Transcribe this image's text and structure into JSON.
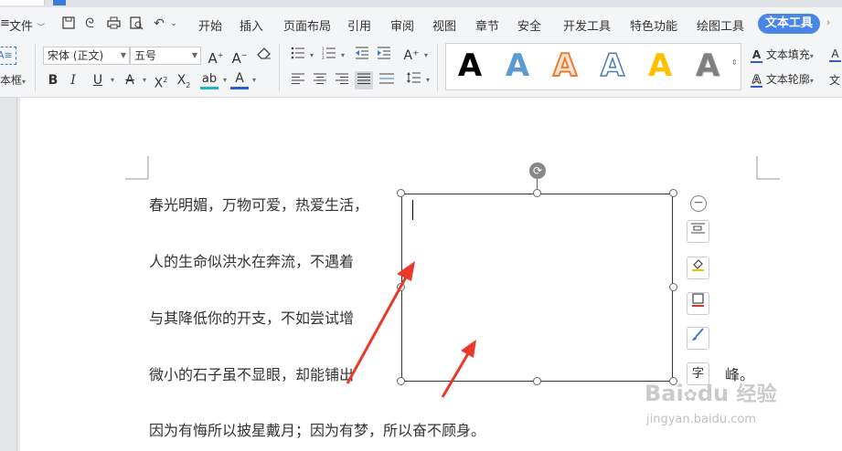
{
  "menubar": {
    "file_label": "文件",
    "tabs": [
      "开始",
      "插入",
      "页面布局",
      "引用",
      "审阅",
      "视图",
      "章节",
      "安全",
      "开发工具",
      "特色功能",
      "绘图工具",
      "文本工具"
    ],
    "active_tab": "文本工具"
  },
  "ribbon": {
    "textbox_label": "本框",
    "font_name": "宋体 (正文)",
    "font_size": "五号",
    "text_fill_label": "文本填充",
    "text_outline_label": "文本轮廓",
    "cut_label": "文"
  },
  "document": {
    "paragraphs": [
      "春光明媚，万物可爱，热爱生活，",
      "人的生命似洪水在奔流，不遇着",
      "与其降低你的开支，不如尝试增",
      "微小的石子虽不显眼，却能铺出",
      "因为有悔所以披星戴月；因为有梦，所以奋不顾身。"
    ],
    "para4_tail": "峰。"
  },
  "textbox_tools": {
    "char_button_label": "字"
  },
  "watermark": {
    "line1": "Bai",
    "line2": "du",
    "line3": "经验",
    "url": "jingyan.baidu.com"
  },
  "colors": {
    "accent": "#4a86e8",
    "arrow": "#e8392b"
  }
}
